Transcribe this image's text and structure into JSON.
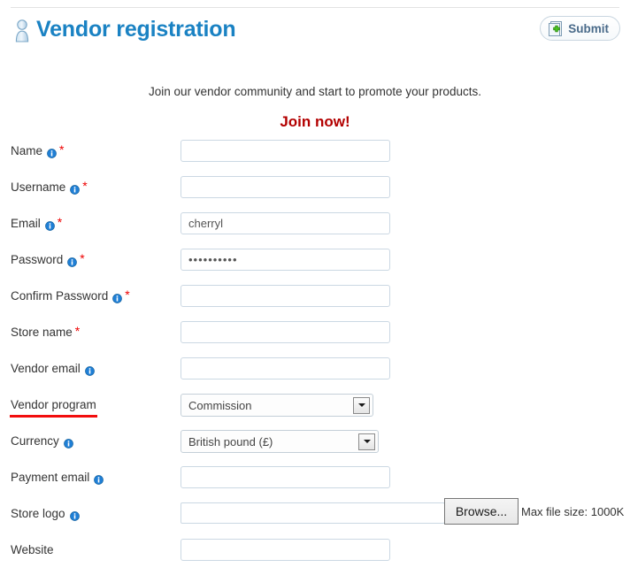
{
  "header": {
    "title": "Vendor registration",
    "title_icon": "user-icon",
    "submit_label": "Submit",
    "submit_icon": "page-add-icon",
    "accent_color": "#1a82c3"
  },
  "intro": {
    "description": "Join our vendor community and start to promote your products.",
    "callout": "Join now!",
    "callout_color": "#b30000"
  },
  "form": {
    "required_marker": "*",
    "info_icon": "info-icon",
    "rows": [
      {
        "label": "Name",
        "has_info": true,
        "required": true,
        "control": "text",
        "value": "",
        "highlight": false
      },
      {
        "label": "Username",
        "has_info": true,
        "required": true,
        "control": "text",
        "value": "",
        "highlight": false
      },
      {
        "label": "Email",
        "has_info": true,
        "required": true,
        "control": "text",
        "value": "cherryl",
        "highlight": false
      },
      {
        "label": "Password",
        "has_info": true,
        "required": true,
        "control": "password",
        "value": "••••••••••",
        "highlight": false
      },
      {
        "label": "Confirm Password",
        "has_info": true,
        "required": true,
        "control": "text",
        "value": "",
        "highlight": false
      },
      {
        "label": "Store name",
        "has_info": false,
        "required": true,
        "control": "text",
        "value": "",
        "highlight": false
      },
      {
        "label": "Vendor email",
        "has_info": true,
        "required": false,
        "control": "text",
        "value": "",
        "highlight": false
      },
      {
        "label": "Vendor program",
        "has_info": false,
        "required": false,
        "control": "select",
        "value": "Commission",
        "highlight": true
      },
      {
        "label": "Currency",
        "has_info": true,
        "required": false,
        "control": "select",
        "value": "British pound (£)",
        "highlight": false
      },
      {
        "label": "Payment email",
        "has_info": true,
        "required": false,
        "control": "text",
        "value": "",
        "highlight": false
      },
      {
        "label": "Store logo",
        "has_info": true,
        "required": false,
        "control": "file",
        "value": "",
        "highlight": false
      },
      {
        "label": "Website",
        "has_info": false,
        "required": false,
        "control": "text",
        "value": "",
        "highlight": false
      }
    ],
    "file_row": {
      "browse_label": "Browse...",
      "max_size_note": "Max file size: 1000K"
    },
    "highlight_color": "#f20d0d"
  }
}
